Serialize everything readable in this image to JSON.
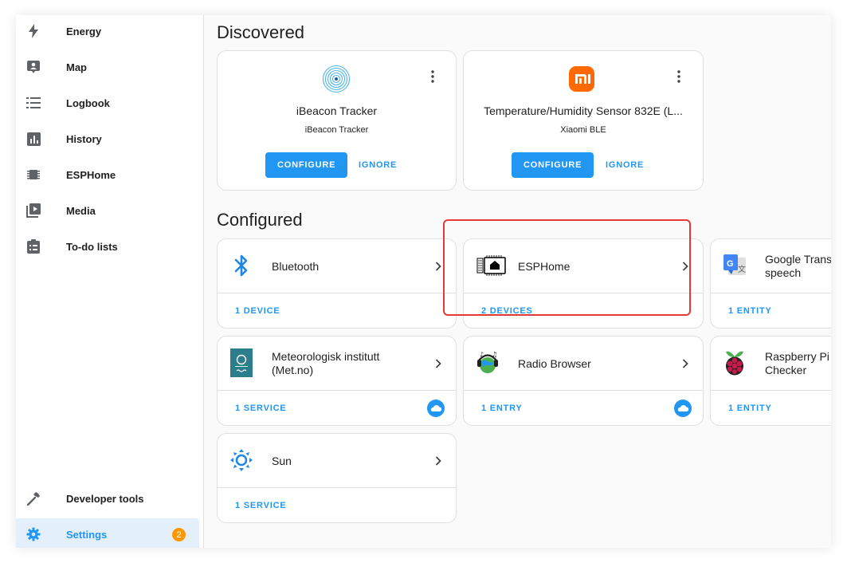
{
  "sidebar": {
    "items": [
      {
        "label": "Energy",
        "icon": "lightning-icon"
      },
      {
        "label": "Map",
        "icon": "map-person-icon"
      },
      {
        "label": "Logbook",
        "icon": "logbook-list-icon"
      },
      {
        "label": "History",
        "icon": "chart-box-icon"
      },
      {
        "label": "ESPHome",
        "icon": "chip-icon"
      },
      {
        "label": "Media",
        "icon": "media-play-icon"
      },
      {
        "label": "To-do lists",
        "icon": "clipboard-list-icon"
      }
    ],
    "bottom": [
      {
        "label": "Developer tools",
        "icon": "hammer-icon"
      },
      {
        "label": "Settings",
        "icon": "gear-icon",
        "badge": "2",
        "active": true
      }
    ]
  },
  "discovered": {
    "title": "Discovered",
    "cards": [
      {
        "title": "iBeacon Tracker",
        "subtitle": "iBeacon Tracker",
        "configure": "CONFIGURE",
        "ignore": "IGNORE"
      },
      {
        "title": "Temperature/Humidity Sensor 832E (L...",
        "subtitle": "Xiaomi BLE",
        "configure": "CONFIGURE",
        "ignore": "IGNORE"
      }
    ]
  },
  "configured": {
    "title": "Configured",
    "cards": [
      {
        "name": "Bluetooth",
        "link": "1 DEVICE"
      },
      {
        "name": "ESPHome",
        "link": "2 DEVICES"
      },
      {
        "name": "Google Trans speech",
        "line1": "Google Trans",
        "line2": "speech",
        "link": "1 ENTITY"
      },
      {
        "name": "Meteorologisk institutt (Met.no)",
        "line1": "Meteorologisk institutt",
        "line2": "(Met.no)",
        "link": "1 SERVICE",
        "cloud": true
      },
      {
        "name": "Radio Browser",
        "link": "1 ENTRY",
        "cloud": true
      },
      {
        "name": "Raspberry Pi Checker",
        "line1": "Raspberry Pi",
        "line2": "Checker",
        "link": "1 ENTITY"
      },
      {
        "name": "Sun",
        "link": "1 SERVICE"
      }
    ]
  },
  "colors": {
    "accent": "#2196f3",
    "badge": "#ff9800",
    "highlight": "#e53935",
    "xiaomi": "#ff6900"
  }
}
